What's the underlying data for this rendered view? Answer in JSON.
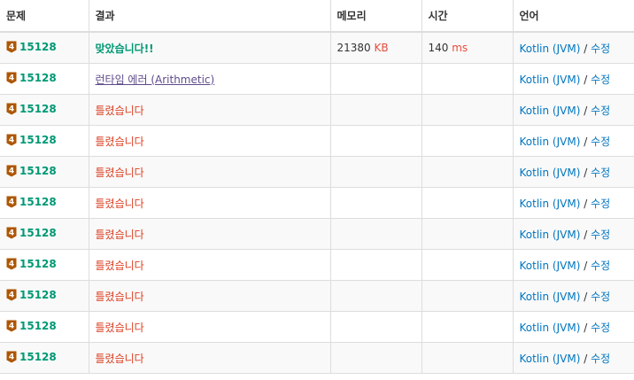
{
  "headers": {
    "problem": "문제",
    "result": "결과",
    "memory": "메모리",
    "time": "시간",
    "language": "언어"
  },
  "colors": {
    "accepted": "#009874",
    "wrong": "#dd4124",
    "runtime_error": "#5f4b8b",
    "link": "#0076c0",
    "unit": "#e74c3c",
    "tier_badge": "#ad5600"
  },
  "rows": [
    {
      "tier": "4",
      "problem_id": "15128",
      "result": "맞았습니다!!",
      "status": "accepted",
      "memory": "21380",
      "memory_unit": "KB",
      "time": "140",
      "time_unit": "ms",
      "language": "Kotlin (JVM)",
      "separator": "/",
      "edit": "수정"
    },
    {
      "tier": "4",
      "problem_id": "15128",
      "result": "런타임 에러 (Arithmetic)",
      "status": "runtime_error",
      "memory": "",
      "memory_unit": "",
      "time": "",
      "time_unit": "",
      "language": "Kotlin (JVM)",
      "separator": "/",
      "edit": "수정"
    },
    {
      "tier": "4",
      "problem_id": "15128",
      "result": "틀렸습니다",
      "status": "wrong",
      "memory": "",
      "memory_unit": "",
      "time": "",
      "time_unit": "",
      "language": "Kotlin (JVM)",
      "separator": "/",
      "edit": "수정"
    },
    {
      "tier": "4",
      "problem_id": "15128",
      "result": "틀렸습니다",
      "status": "wrong",
      "memory": "",
      "memory_unit": "",
      "time": "",
      "time_unit": "",
      "language": "Kotlin (JVM)",
      "separator": "/",
      "edit": "수정"
    },
    {
      "tier": "4",
      "problem_id": "15128",
      "result": "틀렸습니다",
      "status": "wrong",
      "memory": "",
      "memory_unit": "",
      "time": "",
      "time_unit": "",
      "language": "Kotlin (JVM)",
      "separator": "/",
      "edit": "수정"
    },
    {
      "tier": "4",
      "problem_id": "15128",
      "result": "틀렸습니다",
      "status": "wrong",
      "memory": "",
      "memory_unit": "",
      "time": "",
      "time_unit": "",
      "language": "Kotlin (JVM)",
      "separator": "/",
      "edit": "수정"
    },
    {
      "tier": "4",
      "problem_id": "15128",
      "result": "틀렸습니다",
      "status": "wrong",
      "memory": "",
      "memory_unit": "",
      "time": "",
      "time_unit": "",
      "language": "Kotlin (JVM)",
      "separator": "/",
      "edit": "수정"
    },
    {
      "tier": "4",
      "problem_id": "15128",
      "result": "틀렸습니다",
      "status": "wrong",
      "memory": "",
      "memory_unit": "",
      "time": "",
      "time_unit": "",
      "language": "Kotlin (JVM)",
      "separator": "/",
      "edit": "수정"
    },
    {
      "tier": "4",
      "problem_id": "15128",
      "result": "틀렸습니다",
      "status": "wrong",
      "memory": "",
      "memory_unit": "",
      "time": "",
      "time_unit": "",
      "language": "Kotlin (JVM)",
      "separator": "/",
      "edit": "수정"
    },
    {
      "tier": "4",
      "problem_id": "15128",
      "result": "틀렸습니다",
      "status": "wrong",
      "memory": "",
      "memory_unit": "",
      "time": "",
      "time_unit": "",
      "language": "Kotlin (JVM)",
      "separator": "/",
      "edit": "수정"
    },
    {
      "tier": "4",
      "problem_id": "15128",
      "result": "틀렸습니다",
      "status": "wrong",
      "memory": "",
      "memory_unit": "",
      "time": "",
      "time_unit": "",
      "language": "Kotlin (JVM)",
      "separator": "/",
      "edit": "수정"
    }
  ]
}
